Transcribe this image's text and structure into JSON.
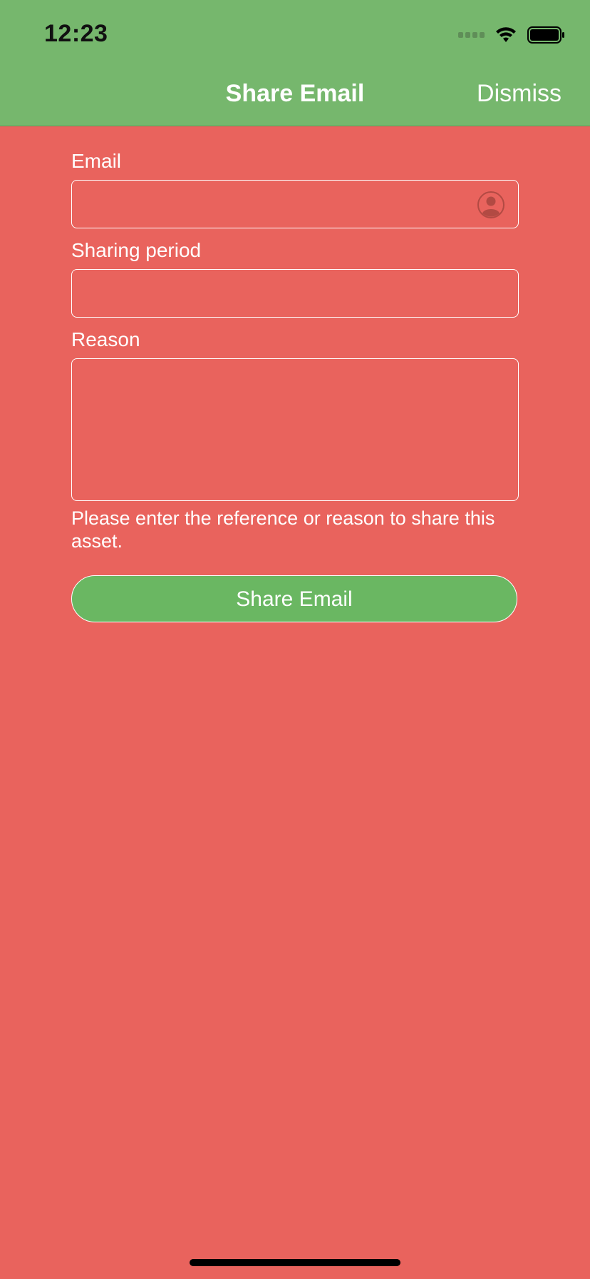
{
  "status_bar": {
    "time": "12:23"
  },
  "nav": {
    "title": "Share Email",
    "dismiss_label": "Dismiss"
  },
  "form": {
    "email_label": "Email",
    "email_value": "",
    "sharing_period_label": "Sharing period",
    "sharing_period_value": "",
    "reason_label": "Reason",
    "reason_value": "",
    "hint": "Please enter the reference or reason to share this asset.",
    "submit_label": "Share Email"
  },
  "icons": {
    "contact": "person-circle-icon",
    "wifi": "wifi-icon",
    "battery": "battery-icon",
    "signal": "cellular-signal-icon"
  },
  "colors": {
    "header": "#76b76d",
    "background": "#e9635d",
    "button": "#6ab762",
    "text": "#ffffff"
  }
}
